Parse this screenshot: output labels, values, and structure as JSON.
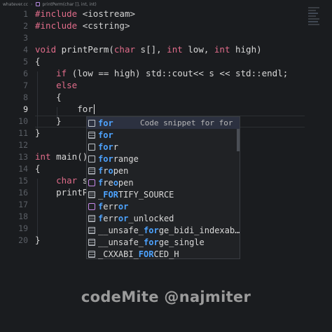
{
  "breadcrumb": {
    "file": "whatever.cc",
    "symbol": "printPerm(char [], int, int)"
  },
  "editor": {
    "lines": [
      {
        "n": "1",
        "text": "#include <iostream>"
      },
      {
        "n": "2",
        "text": "#include <cstring>"
      },
      {
        "n": "3",
        "text": ""
      },
      {
        "n": "4",
        "text": "void printPerm(char s[], int low, int high)"
      },
      {
        "n": "5",
        "text": "{"
      },
      {
        "n": "6",
        "text": "    if (low == high) std::cout<< s << std::endl;"
      },
      {
        "n": "7",
        "text": "    else"
      },
      {
        "n": "8",
        "text": "    {"
      },
      {
        "n": "9",
        "text": "        for"
      },
      {
        "n": "10",
        "text": "    }"
      },
      {
        "n": "11",
        "text": "}"
      },
      {
        "n": "12",
        "text": ""
      },
      {
        "n": "13",
        "text": "int main()"
      },
      {
        "n": "14",
        "text": "{"
      },
      {
        "n": "15",
        "text": "    char s["
      },
      {
        "n": "16",
        "text": "    printPe"
      },
      {
        "n": "17",
        "text": ""
      },
      {
        "n": "18",
        "text": ""
      },
      {
        "n": "19",
        "text": ""
      },
      {
        "n": "20",
        "text": "}"
      }
    ],
    "visible_numbers": {
      "9": "9",
      "10": "10",
      "11": "11",
      "12": "12",
      "13": "13",
      "14": "14",
      "15": "15",
      "16": "16",
      "17": "17",
      "18": "18",
      "19": "19",
      "20": "20"
    }
  },
  "autocomplete": {
    "items": [
      {
        "icon": "snippet-icon",
        "match": "for",
        "rest": "",
        "detail": "Code snippet for for l…",
        "selected": true
      },
      {
        "icon": "keyword-icon",
        "match": "for",
        "rest": "",
        "detail": "",
        "selected": false
      },
      {
        "icon": "snippet-icon",
        "match": "for",
        "rest": "r",
        "detail": "",
        "selected": false
      },
      {
        "icon": "snippet-icon",
        "match": "for",
        "rest": "range",
        "detail": "",
        "selected": false
      },
      {
        "icon": "function-icon",
        "match": "fo",
        "rest": "pen",
        "prefix": "",
        "detail": "",
        "selected": false
      },
      {
        "icon": "method-icon",
        "match": "f",
        "rest": "eopen",
        "prefix2": "r",
        "detail": "",
        "selected": false
      },
      {
        "icon": "function-icon",
        "match": "",
        "rest": "",
        "detail": "",
        "selected": false
      },
      {
        "icon": "method-icon",
        "match": "",
        "rest": "",
        "detail": "",
        "selected": false
      },
      {
        "icon": "function-icon",
        "match": "",
        "rest": "",
        "detail": "",
        "selected": false
      },
      {
        "icon": "function-icon",
        "match": "",
        "rest": "",
        "detail": "",
        "selected": false
      },
      {
        "icon": "function-icon",
        "match": "",
        "rest": "",
        "detail": "",
        "selected": false
      },
      {
        "icon": "function-icon",
        "match": "",
        "rest": "",
        "detail": "",
        "selected": false
      }
    ],
    "labels": [
      "for",
      "for",
      "forr",
      "forrange",
      "fropen",
      "freopen",
      "_FORTIFY_SOURCE",
      "ferror",
      "ferror_unlocked",
      "__unsafe_forge_bidi_indexab…",
      "__unsafe_forge_single",
      "_CXXABI_FORCED_H"
    ],
    "detail_selected": "Code snippet for for l…"
  },
  "watermark": "codeMite @najmiter",
  "colors": {
    "background": "#1a1c1f",
    "keyword": "#e06c8a",
    "match_highlight": "#4da3ff",
    "selected_row": "#2c3140"
  }
}
